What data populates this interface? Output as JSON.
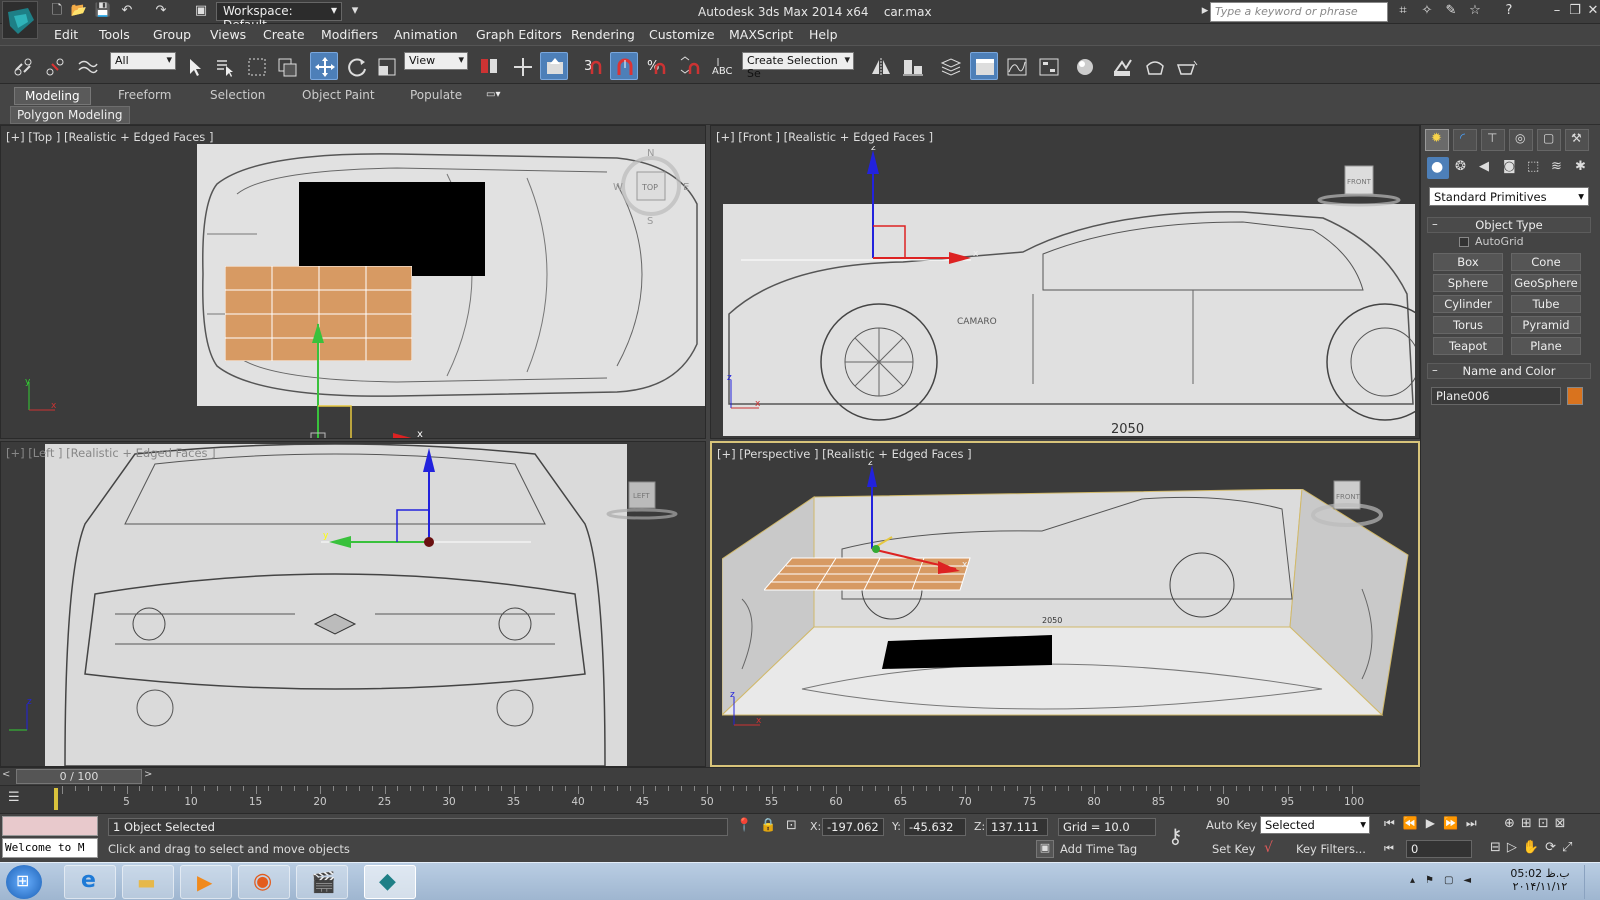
{
  "title_bar": {
    "workspace": "Workspace: Default",
    "app_title": "Autodesk 3ds Max  2014 x64",
    "file_name": "car.max",
    "search_placeholder": "Type a keyword or phrase"
  },
  "menu": [
    "Edit",
    "Tools",
    "Group",
    "Views",
    "Create",
    "Modifiers",
    "Animation",
    "Graph Editors",
    "Rendering",
    "Customize",
    "MAXScript",
    "Help"
  ],
  "toolbar": {
    "selection_filter": "All",
    "ref_coord": "View",
    "named_selection": "Create Selection Se"
  },
  "ribbon": {
    "tabs": [
      "Modeling",
      "Freeform",
      "Selection",
      "Object Paint",
      "Populate"
    ],
    "active_tab": "Modeling",
    "panel": "Polygon Modeling"
  },
  "viewports": {
    "top": {
      "label": "[+] [Top ] [Realistic + Edged Faces ]",
      "cube": "TOP",
      "compass": [
        "N",
        "E",
        "S",
        "W"
      ]
    },
    "front": {
      "label": "[+] [Front ] [Realistic + Edged Faces ]",
      "cube": "FRONT",
      "blueprint_text": "2050",
      "model_text": "CAMARO"
    },
    "left": {
      "label": "[+] [Left ] [Realistic + Edged Faces ]",
      "cube": "LEFT"
    },
    "perspective": {
      "label": "[+] [Perspective ] [Realistic + Edged Faces ]",
      "cube": "FRONT",
      "blueprint_text": "2050"
    }
  },
  "command_panel": {
    "dropdown": "Standard Primitives",
    "object_type": "Object Type",
    "autogrid": "AutoGrid",
    "buttons": [
      "Box",
      "Cone",
      "Sphere",
      "GeoSphere",
      "Cylinder",
      "Tube",
      "Torus",
      "Pyramid",
      "Teapot",
      "Plane"
    ],
    "name_and_color": "Name and Color",
    "object_name": "Plane006",
    "object_color": "#d9731e"
  },
  "timeline": {
    "frame": "0 / 100",
    "ticks": [
      "5",
      "10",
      "15",
      "20",
      "25",
      "30",
      "35",
      "40",
      "45",
      "50",
      "55",
      "60",
      "65",
      "70",
      "75",
      "80",
      "85",
      "90",
      "95",
      "100"
    ]
  },
  "status": {
    "selected": "1 Object Selected",
    "prompt": "Click and drag to select and move objects",
    "x_label": "X:",
    "x": "-197.062",
    "y_label": "Y:",
    "y": "-45.632",
    "z_label": "Z:",
    "z": "137.111",
    "grid": "Grid = 10.0",
    "add_time_tag": "Add Time Tag",
    "auto_key": "Auto Key",
    "set_key": "Set Key",
    "key_mode": "Selected",
    "key_filters": "Key Filters...",
    "current_frame": "0",
    "maxscript_listener": "Welcome to M"
  },
  "taskbar": {
    "clock_time": "05:02 ب.ظ",
    "clock_date": "۲۰۱۴/۱۱/۱۲"
  }
}
